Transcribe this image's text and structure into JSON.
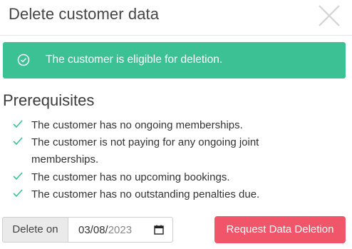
{
  "modal": {
    "title": "Delete customer data",
    "close_icon": "close-icon"
  },
  "alert": {
    "icon": "check-circle-icon",
    "text": "The customer is eligible for deletion.",
    "color": "#3cc195"
  },
  "prerequisites": {
    "heading": "Prerequisites",
    "items": [
      {
        "line1": "The customer has no ongoing memberships.",
        "line2": ""
      },
      {
        "line1": "The customer is not paying for any ongoing joint",
        "line2": "memberships."
      },
      {
        "line1": "The customer has no upcoming bookings.",
        "line2": ""
      },
      {
        "line1": "The customer has no outstanding penalties due.",
        "line2": ""
      }
    ],
    "check_color": "#3cc195"
  },
  "form": {
    "delete_on_label": "Delete on",
    "date_value": "03/08/",
    "date_year": "2023",
    "calendar_icon": "calendar-icon"
  },
  "actions": {
    "request_label": "Request Data Deletion",
    "request_color": "#f05569"
  }
}
